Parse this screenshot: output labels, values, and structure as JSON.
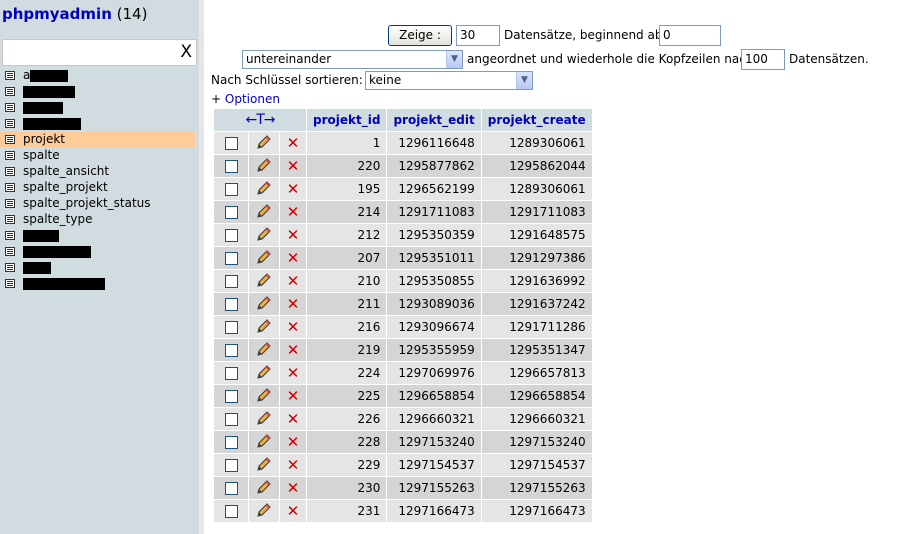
{
  "nav": {
    "db_name": "phpmyadmin",
    "table_count": "(14)",
    "filter_value": "",
    "filter_clear": "X",
    "tables": [
      {
        "label": "a",
        "redacted": true,
        "redact_width": 38
      },
      {
        "label": "",
        "redacted": true,
        "redact_width": 52
      },
      {
        "label": "",
        "redacted": true,
        "redact_width": 40
      },
      {
        "label": "",
        "redacted": true,
        "redact_width": 58
      },
      {
        "label": "projekt",
        "redacted": false,
        "active": true
      },
      {
        "label": "spalte",
        "redacted": false
      },
      {
        "label": "spalte_ansicht",
        "redacted": false
      },
      {
        "label": "spalte_projekt",
        "redacted": false
      },
      {
        "label": "spalte_projekt_status",
        "redacted": false
      },
      {
        "label": "spalte_type",
        "redacted": false
      },
      {
        "label": "",
        "redacted": true,
        "redact_width": 36
      },
      {
        "label": "",
        "redacted": true,
        "redact_width": 68
      },
      {
        "label": "",
        "redacted": true,
        "redact_width": 28
      },
      {
        "label": "",
        "redacted": true,
        "redact_width": 82
      }
    ]
  },
  "controls": {
    "show_button": "Zeige :",
    "rows_value": "30",
    "rows_label": "Datensätze, beginnend ab",
    "start_value": "0",
    "mode_select": "untereinander",
    "mode_label": "angeordnet und wiederhole die Kopfzeilen nach",
    "repeat_value": "100",
    "repeat_label": "Datensätzen.",
    "sort_label": "Nach Schlüssel sortieren:",
    "sort_select": "keine",
    "options_plus": "+",
    "options_link": "Optionen"
  },
  "table": {
    "columns": [
      "projekt_id",
      "projekt_edit",
      "projekt_create"
    ],
    "rows": [
      [
        "1",
        "1296116648",
        "1289306061"
      ],
      [
        "220",
        "1295877862",
        "1295862044"
      ],
      [
        "195",
        "1296562199",
        "1289306061"
      ],
      [
        "214",
        "1291711083",
        "1291711083"
      ],
      [
        "212",
        "1295350359",
        "1291648575"
      ],
      [
        "207",
        "1295351011",
        "1291297386"
      ],
      [
        "210",
        "1295350855",
        "1291636992"
      ],
      [
        "211",
        "1293089036",
        "1291637242"
      ],
      [
        "216",
        "1293096674",
        "1291711286"
      ],
      [
        "219",
        "1295355959",
        "1295351347"
      ],
      [
        "224",
        "1297069976",
        "1296657813"
      ],
      [
        "225",
        "1296658854",
        "1296658854"
      ],
      [
        "226",
        "1296660321",
        "1296660321"
      ],
      [
        "228",
        "1297153240",
        "1297153240"
      ],
      [
        "229",
        "1297154537",
        "1297154537"
      ],
      [
        "230",
        "1297155263",
        "1297155263"
      ],
      [
        "231",
        "1297166473",
        "1297166473"
      ]
    ]
  },
  "colors": {
    "nav_bg": "#d0dce0",
    "active_row": "#ffcc99",
    "link": "#0000c0",
    "delete": "#d00000"
  }
}
